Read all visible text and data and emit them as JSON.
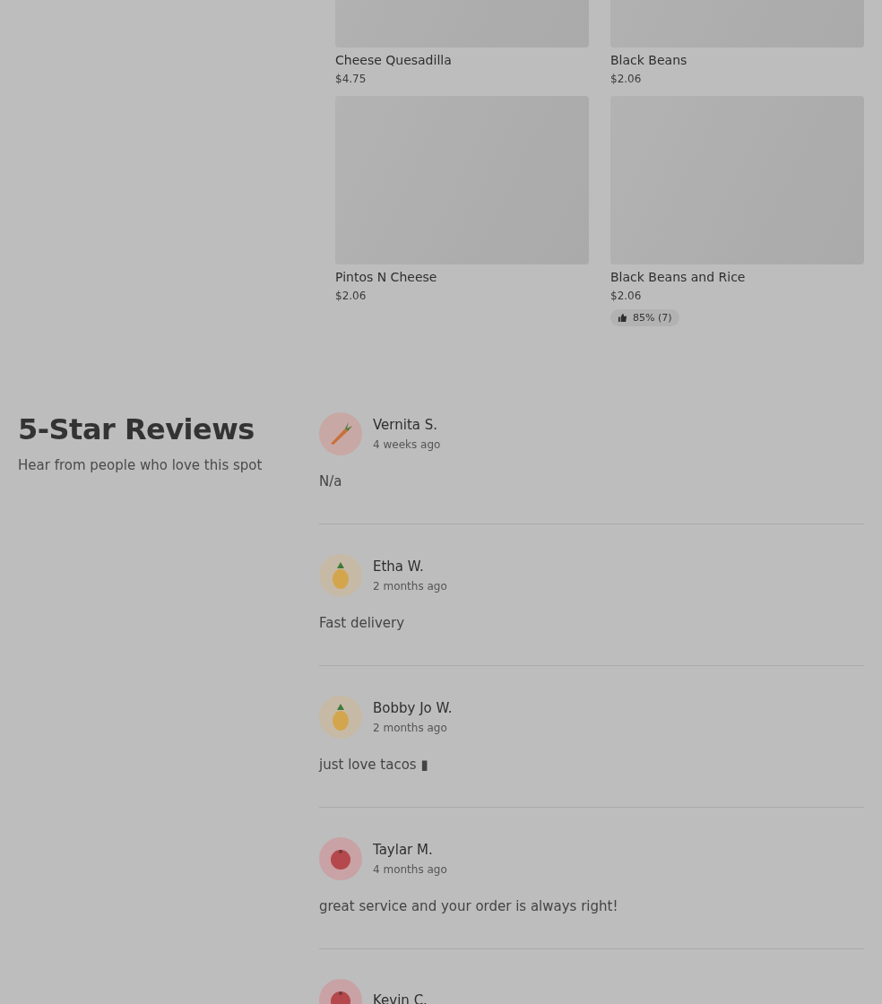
{
  "menu_items": [
    {
      "name": "Cheese Quesadilla",
      "price": "$4.75"
    },
    {
      "name": "Black Beans",
      "price": "$2.06"
    },
    {
      "name": "Pintos N Cheese",
      "price": "$2.06"
    },
    {
      "name": "Black Beans and Rice",
      "price": "$2.06",
      "rating": "85% (7)"
    }
  ],
  "reviews_section": {
    "title": "5-Star Reviews",
    "subtitle": "Hear from people who love this spot",
    "reviews": [
      {
        "name": "Vernita S.",
        "time": "4 weeks ago",
        "text": "N/a",
        "kind": "carrot"
      },
      {
        "name": "Etha W.",
        "time": "2 months ago",
        "text": "Fast delivery",
        "kind": "pineapple"
      },
      {
        "name": "Bobby Jo W.",
        "time": "2 months ago",
        "text": "just love tacos ▮",
        "kind": "pineapple"
      },
      {
        "name": "Taylar M.",
        "time": "4 months ago",
        "text": "great service and your order is always right!",
        "kind": "tomato"
      },
      {
        "name": "Kevin C.",
        "kind": "tomato"
      }
    ]
  }
}
